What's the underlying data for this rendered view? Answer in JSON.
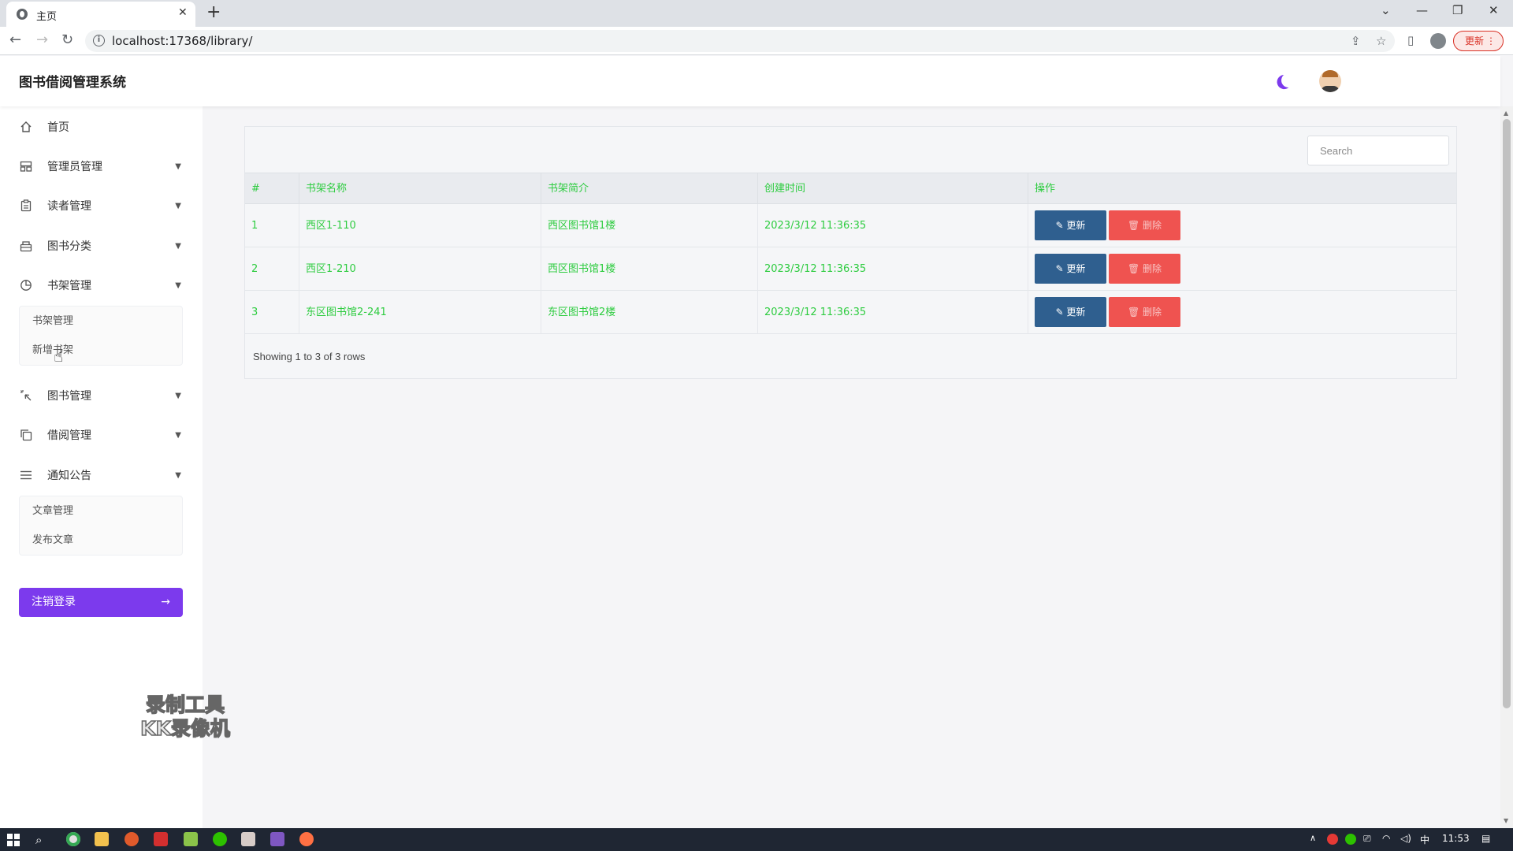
{
  "browser": {
    "tab_title": "主页",
    "url": "localhost:17368/library/",
    "update_label": "更新"
  },
  "app": {
    "brand": "图书借阅管理系统"
  },
  "sidebar": {
    "items": [
      {
        "label": "首页",
        "icon": "home-icon"
      },
      {
        "label": "管理员管理",
        "icon": "admin-icon"
      },
      {
        "label": "读者管理",
        "icon": "reader-icon"
      },
      {
        "label": "图书分类",
        "icon": "category-icon"
      },
      {
        "label": "书架管理",
        "icon": "shelf-icon"
      },
      {
        "label": "图书管理",
        "icon": "book-icon"
      },
      {
        "label": "借阅管理",
        "icon": "borrow-icon"
      },
      {
        "label": "通知公告",
        "icon": "notice-icon"
      }
    ],
    "shelf_submenu": [
      "书架管理",
      "新增书架"
    ],
    "notice_submenu": [
      "文章管理",
      "发布文章"
    ],
    "logout_label": "注销登录"
  },
  "watermark": {
    "line1": "录制工具",
    "line2": "KK录像机"
  },
  "table": {
    "search_placeholder": "Search",
    "columns": [
      "#",
      "书架名称",
      "书架简介",
      "创建时间",
      "操作"
    ],
    "rows": [
      {
        "id": "1",
        "name": "西区1-110",
        "desc": "西区图书馆1楼",
        "created": "2023/3/12 11:36:35"
      },
      {
        "id": "2",
        "name": "西区1-210",
        "desc": "西区图书馆1楼",
        "created": "2023/3/12 11:36:35"
      },
      {
        "id": "3",
        "name": "东区图书馆2-241",
        "desc": "东区图书馆2楼",
        "created": "2023/3/12 11:36:35"
      }
    ],
    "update_label": "✎ 更新",
    "delete_label": "🗑 删除",
    "pagination": "Showing 1 to 3 of 3 rows"
  },
  "taskbar": {
    "ime": "中",
    "clock": "11:53"
  },
  "colors": {
    "accent": "#7c3aed",
    "table_text": "#2ecc40",
    "update_button": "#2f5f8f",
    "delete_button": "#ef5350"
  }
}
